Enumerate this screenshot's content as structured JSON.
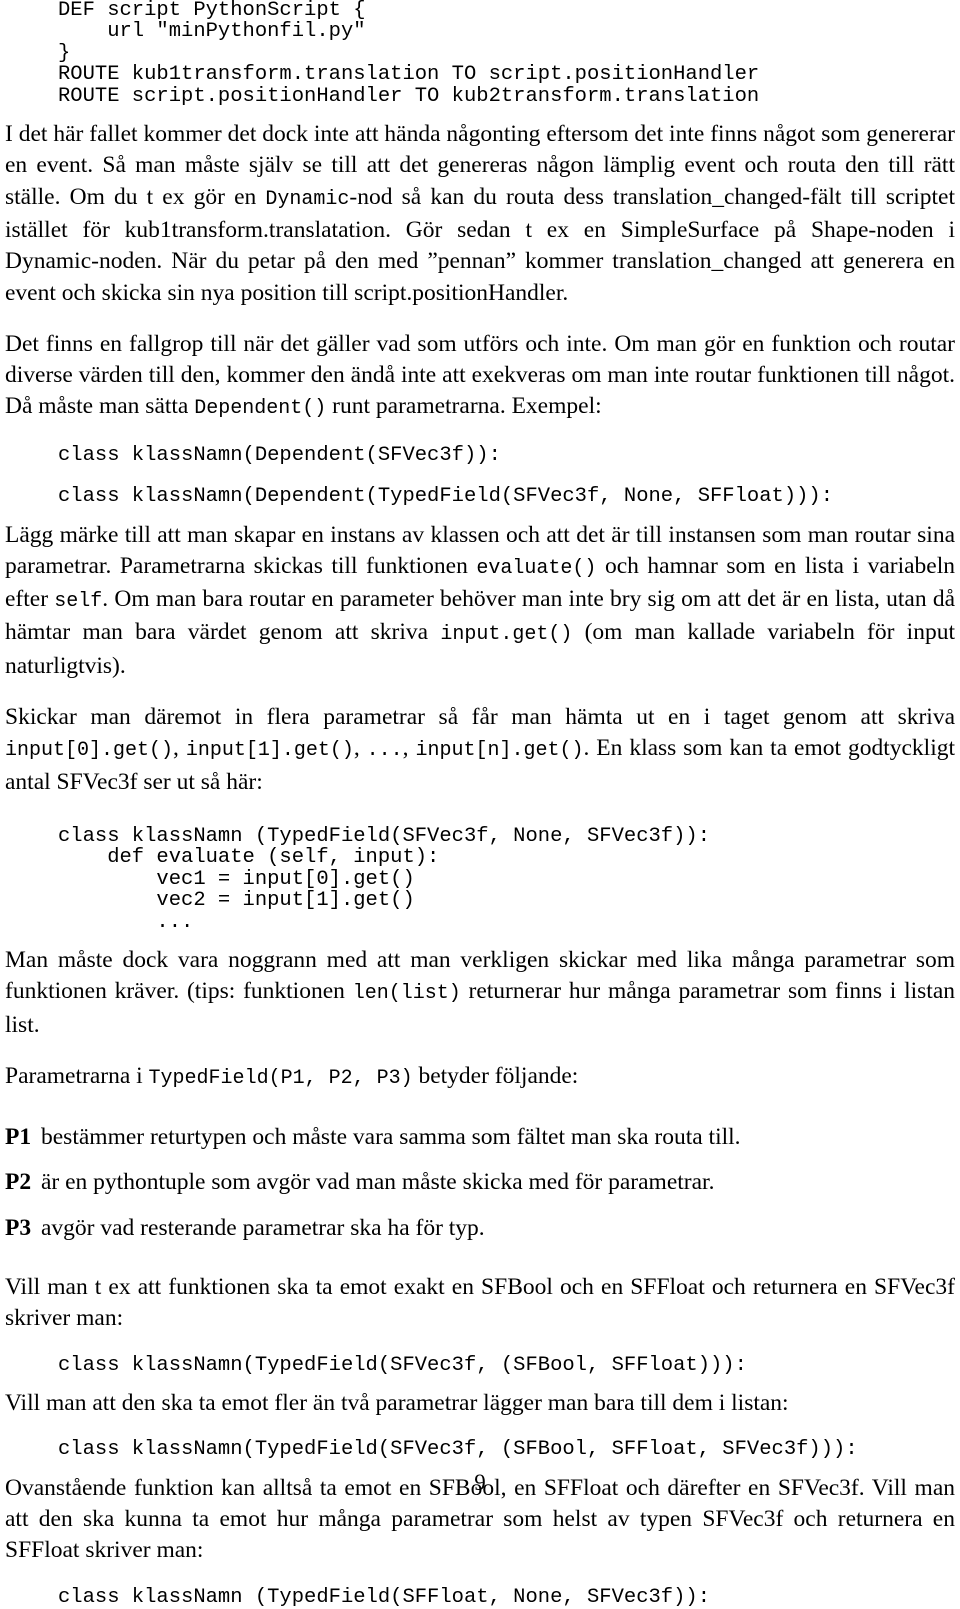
{
  "document": {
    "page_number": "9",
    "language": "sv"
  },
  "blocks": {
    "code_route": "DEF script PythonScript {\n    url \"minPythonfil.py\"\n}\nROUTE kub1transform.translation TO script.positionHandler\nROUTE script.positionHandler TO kub2transform.translation",
    "para_event": {
      "t1": "I det här fallet kommer det dock inte att hända någonting eftersom det inte finns något som genererar en event. Så man måste själv se till att det genereras någon lämplig event och routa den till rätt ställe. Om du t ex gör en ",
      "c1": "Dynamic",
      "t2": "-nod så kan du routa dess translation_changed-fält till scriptet istället för kub1transform.translatation. Gör sedan t ex en SimpleSurface på Shape-noden i Dynamic-noden. När du petar på den med ”pennan” kommer translation_changed att generera en event och skicka sin nya position till script.positionHandler."
    },
    "para_fallgrop": {
      "t1": "Det finns en fallgrop till när det gäller vad som utförs och inte. Om man gör en funktion och routar diverse värden till den, kommer den ändå inte att exekveras om man inte routar funktionen till något. Då måste man sätta ",
      "c1": "Dependent()",
      "t2": " runt parametrarna. Exempel:"
    },
    "code_dependent_1": "class klassNamn(Dependent(SFVec3f)):",
    "code_dependent_2": "class klassNamn(Dependent(TypedField(SFVec3f, None, SFFloat))):",
    "para_instans": {
      "t1": "Lägg märke till att man skapar en instans av klassen och att det är till instansen som man routar sina parametrar. Parametrarna skickas till funktionen ",
      "c1": "evaluate()",
      "t2": " och hamnar som en lista i variabeln efter ",
      "c2": "self",
      "t3": ". Om man bara routar en parameter behöver man inte bry sig om att det är en lista, utan då hämtar man bara värdet genom att skriva ",
      "c3": "input.get()",
      "t4": " (om man kallade variabeln för input naturligtvis)."
    },
    "para_skickar": {
      "t1": "Skickar man däremot in flera parametrar så får man hämta ut en i taget genom att skriva ",
      "c1": "input[0].get()",
      "t2": ", ",
      "c2": "input[1].get()",
      "t3": ", ",
      "c3": "...",
      "t4": ", ",
      "c4": "input[n].get()",
      "t5": ". En klass som kan ta emot godtyckligt antal SFVec3f ser ut så här:"
    },
    "code_evaluate": "class klassNamn (TypedField(SFVec3f, None, SFVec3f)):\n    def evaluate (self, input):\n        vec1 = input[0].get()\n        vec2 = input[1].get()\n        ...",
    "para_noggrann": {
      "t1": "Man måste dock vara noggrann med att man verkligen skickar med lika många parametrar som funktionen kräver. (tips: funktionen ",
      "c1": "len(list)",
      "t2": " returnerar hur många parametrar som finns i listan list."
    },
    "para_parametrarna": {
      "t1": "Parametrarna i ",
      "c1": "TypedField(P1, P2, P3)",
      "t2": " betyder följande:"
    },
    "deflist": [
      {
        "label": "P1",
        "text": "bestämmer returtypen och måste vara samma som fältet man ska routa till."
      },
      {
        "label": "P2",
        "text": "är en pythontuple som avgör vad man måste skicka med för parametrar."
      },
      {
        "label": "P3",
        "text": "avgör vad resterande parametrar ska ha för typ."
      }
    ],
    "para_vill_man": "Vill man t ex att funktionen ska ta emot exakt en SFBool och en SFFloat och returnera en SFVec3f skriver man:",
    "code_sfbool_sffloat": "class klassNamn(TypedField(SFVec3f, (SFBool, SFFloat))):",
    "para_fler_an_tva": "Vill man att den ska ta emot fler än två parametrar lägger man bara till dem i listan:",
    "code_sfbool_sffloat_sfvec3f": "class klassNamn(TypedField(SFVec3f, (SFBool, SFFloat, SFVec3f))):",
    "para_ovanstaende": "Ovanstående funktion kan alltså ta emot en SFBool, en SFFloat och därefter en SFVec3f. Vill man att den ska kunna ta emot hur många parametrar som helst av typen SFVec3f och returnera en SFFloat skriver man:",
    "code_sffloat_sfvec3f": "class klassNamn (TypedField(SFFloat, None, SFVec3f)):"
  }
}
